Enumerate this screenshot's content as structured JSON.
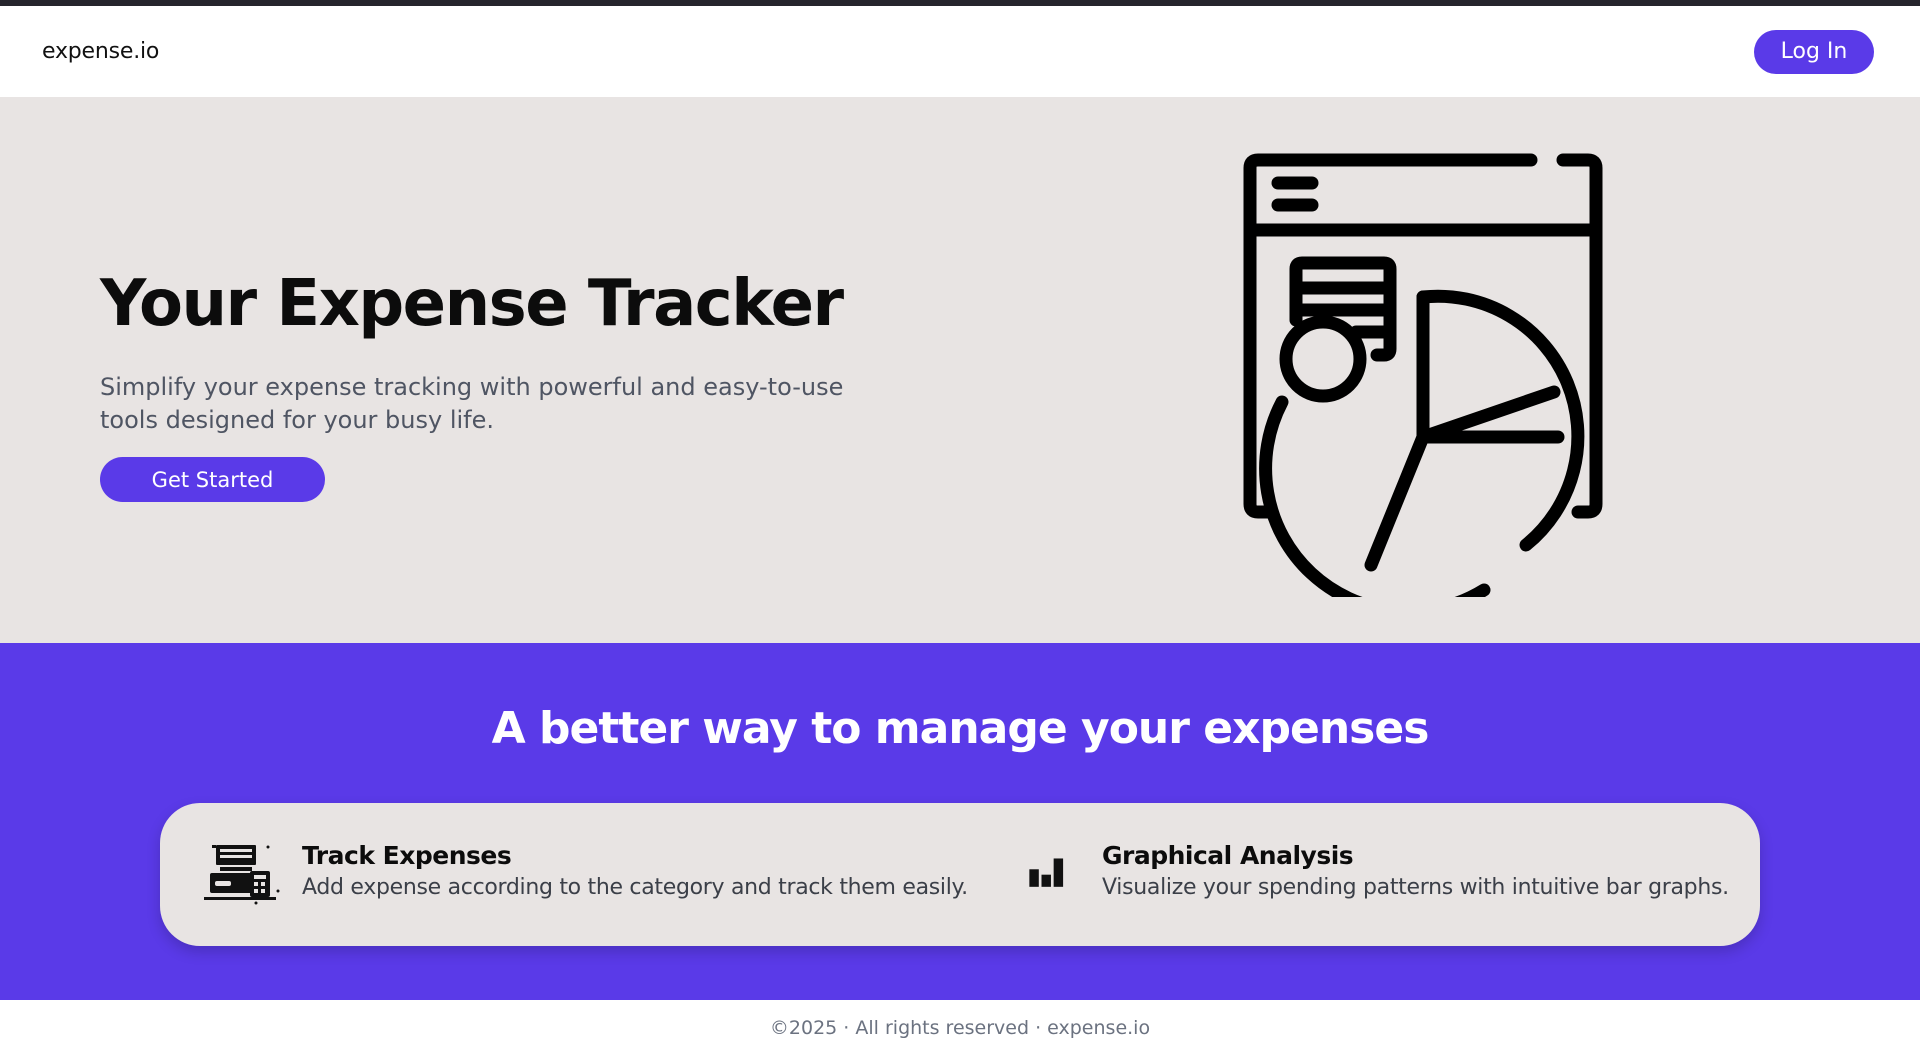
{
  "header": {
    "brand": "expense.io",
    "login_label": "Log In"
  },
  "hero": {
    "title": "Your Expense Tracker",
    "subtitle": "Simplify your expense tracking with powerful and easy-to-use tools designed for your busy life.",
    "cta_label": "Get Started",
    "illustration_icon": "dashboard-pie-chart-icon"
  },
  "features": {
    "title": "A better way to manage your expenses",
    "items": [
      {
        "icon": "register-calculator-icon",
        "title": "Track Expenses",
        "description": "Add expense according to the category and track them easily."
      },
      {
        "icon": "bar-chart-icon",
        "title": "Graphical Analysis",
        "description": "Visualize your spending patterns with intuitive bar graphs."
      }
    ]
  },
  "footer": {
    "text": "©2025 · All rights reserved · expense.io"
  },
  "colors": {
    "accent": "#5a3ae8",
    "hero_bg": "#e8e4e3",
    "top_bar": "#26252c",
    "text_dark": "#0c0c0c",
    "text_muted": "#4f5563"
  }
}
